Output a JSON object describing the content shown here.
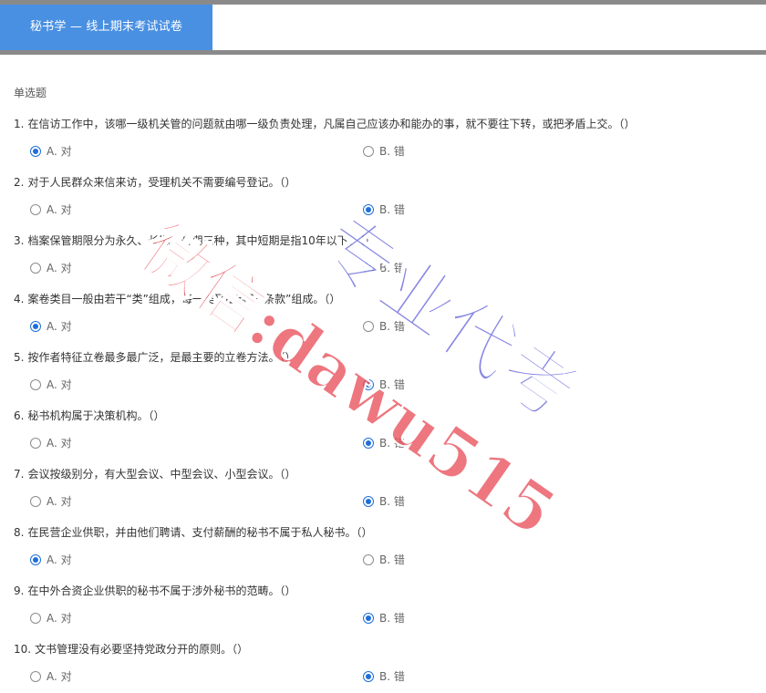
{
  "tabs": [
    {
      "label": "秘书学 — 线上期末考试试卷"
    }
  ],
  "section": {
    "title": "单选题"
  },
  "questions": [
    {
      "number": "1.",
      "text": "在信访工作中，该哪一级机关管的问题就由哪一级负责处理，凡属自己应该办和能办的事，就不要往下转，或把矛盾上交。（）",
      "option_a": "A. 对",
      "option_b": "B. 错",
      "selected": "A"
    },
    {
      "number": "2.",
      "text": "对于人民群众来信来访，受理机关不需要编号登记。（）",
      "option_a": "A. 对",
      "option_b": "B. 错",
      "selected": "B"
    },
    {
      "number": "3.",
      "text": "档案保管期限分为永久、长期和短期三种，其中短期是指10年以下。（）",
      "option_a": "A. 对",
      "option_b": "B. 错",
      "selected": "B"
    },
    {
      "number": "4.",
      "text": "案卷类目一般由若干“类”组成，每一类又由若干“条款”组成。（）",
      "option_a": "A. 对",
      "option_b": "B. 错",
      "selected": "A"
    },
    {
      "number": "5.",
      "text": "按作者特征立卷最多最广泛，是最主要的立卷方法。（）",
      "option_a": "A. 对",
      "option_b": "B. 错",
      "selected": "B"
    },
    {
      "number": "6.",
      "text": "秘书机构属于决策机构。（）",
      "option_a": "A. 对",
      "option_b": "B. 错",
      "selected": "B"
    },
    {
      "number": "7.",
      "text": "会议按级别分，有大型会议、中型会议、小型会议。（）",
      "option_a": "A. 对",
      "option_b": "B. 错",
      "selected": "B"
    },
    {
      "number": "8.",
      "text": "在民营企业供职，并由他们聘请、支付薪酬的秘书不属于私人秘书。（）",
      "option_a": "A. 对",
      "option_b": "B. 错",
      "selected": "A"
    },
    {
      "number": "9.",
      "text": "在中外合资企业供职的秘书不属于涉外秘书的范畴。（）",
      "option_a": "A. 对",
      "option_b": "B. 错",
      "selected": "B"
    },
    {
      "number": "10.",
      "text": "文书管理没有必要坚持党政分开的原则。（）",
      "option_a": "A. 对",
      "option_b": "B. 错",
      "selected": "B"
    }
  ],
  "watermark": {
    "line1": "微信:dawu515",
    "line2": "专业代考",
    "color1": "#e8505b",
    "color2": "#5a5ad8"
  }
}
